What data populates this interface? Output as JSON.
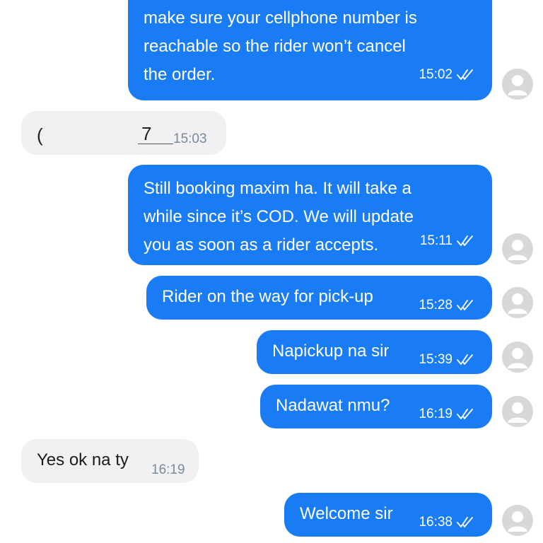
{
  "messages": [
    {
      "id": "m1",
      "direction": "out",
      "text": "make sure your cellphone number is\nreachable so the rider won’t cancel\nthe order.",
      "time": "15:02",
      "status": "read"
    },
    {
      "id": "m2",
      "direction": "in",
      "text_fragment_left": "(",
      "text_fragment_right": "7",
      "time": "15:03"
    },
    {
      "id": "m3",
      "direction": "out",
      "text": "Still booking maxim ha. It will take a\nwhile since it’s COD. We will update\nyou as soon as a rider accepts.",
      "time": "15:11",
      "status": "read"
    },
    {
      "id": "m4",
      "direction": "out",
      "text": "Rider on the way for pick-up",
      "time": "15:28",
      "status": "read"
    },
    {
      "id": "m5",
      "direction": "out",
      "text": "Napickup na sir",
      "time": "15:39",
      "status": "read"
    },
    {
      "id": "m6",
      "direction": "out",
      "text": "Nadawat nmu?",
      "time": "16:19",
      "status": "read"
    },
    {
      "id": "m7",
      "direction": "in",
      "text": "Yes ok na ty",
      "time": "16:19"
    },
    {
      "id": "m8",
      "direction": "out",
      "text": "Welcome sir",
      "time": "16:38",
      "status": "read"
    }
  ],
  "colors": {
    "outgoing_bubble": "#1a7cf5",
    "incoming_bubble": "#f1f1f3",
    "avatar_placeholder": "#d8d8da"
  },
  "icons": {
    "read_receipt": "double-check-icon",
    "avatar": "default-avatar-icon"
  }
}
